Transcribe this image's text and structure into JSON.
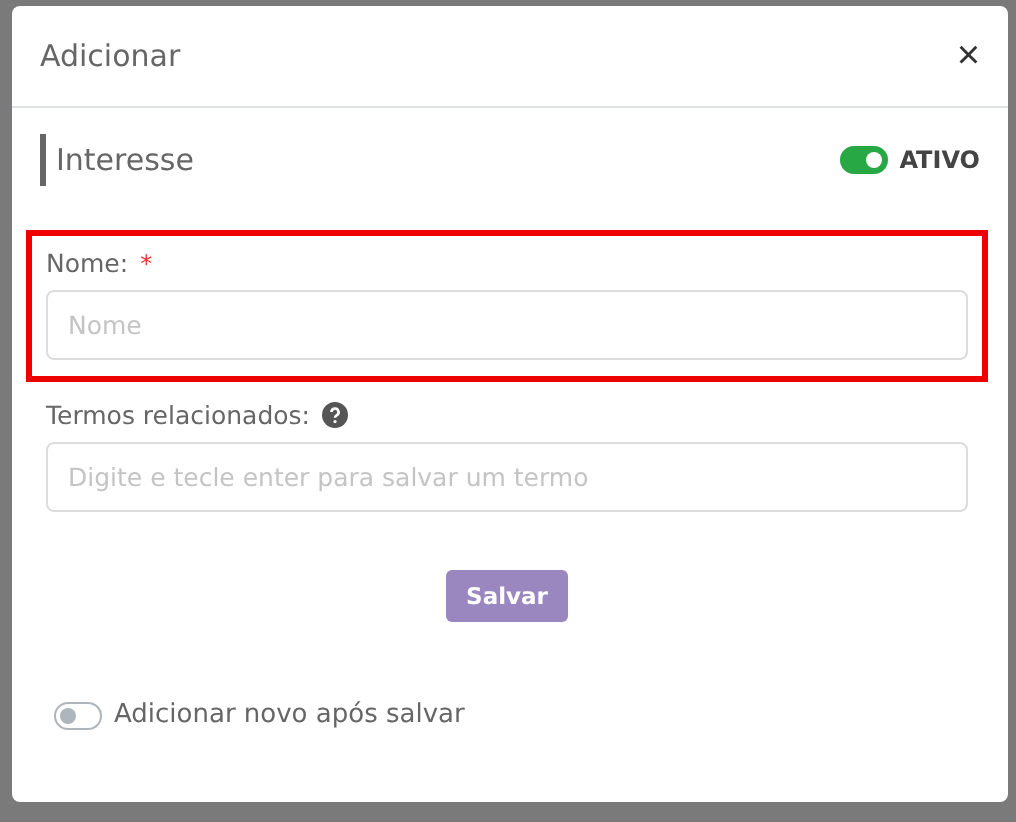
{
  "dialog": {
    "title": "Adicionar",
    "close": "×"
  },
  "section": {
    "title": "Interesse",
    "toggle": {
      "label": "ATIVO",
      "on": true
    }
  },
  "fields": [
    {
      "label": "Nome:",
      "required_mark": "*",
      "placeholder": "Nome",
      "highlighted": true
    },
    {
      "label": "Termos relacionados:",
      "placeholder": "Digite e tecle enter para salvar um termo",
      "highlighted": false,
      "help": true
    }
  ],
  "buttons": [
    "Salvar"
  ],
  "footer_toggle": {
    "label": "Adicionar novo após salvar",
    "on": false
  }
}
